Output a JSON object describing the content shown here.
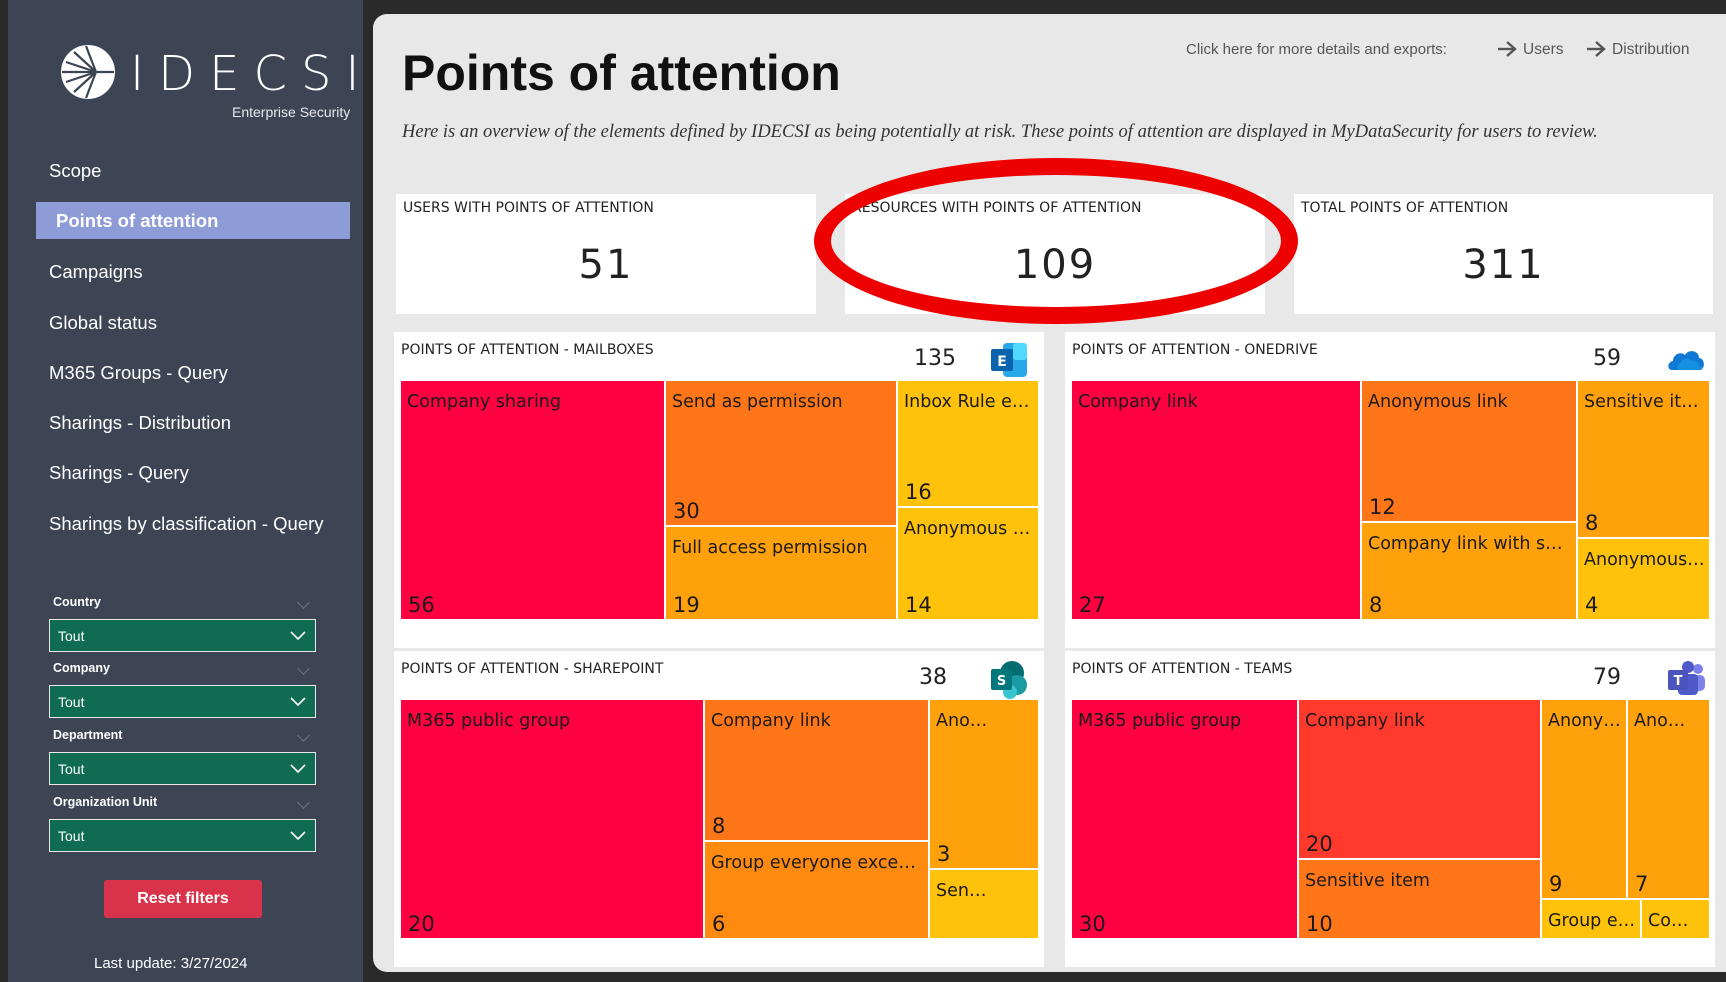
{
  "brand": {
    "name": "IDECSI",
    "tagline": "Enterprise Security"
  },
  "sidebar": {
    "items": [
      {
        "label": "Scope"
      },
      {
        "label": "Points of attention"
      },
      {
        "label": "Campaigns"
      },
      {
        "label": "Global status"
      },
      {
        "label": "M365 Groups - Query"
      },
      {
        "label": "Sharings - Distribution"
      },
      {
        "label": "Sharings - Query"
      },
      {
        "label": "Sharings by classification - Query"
      }
    ],
    "active_item": "Points of attention",
    "filters": [
      {
        "label": "Country",
        "value": "Tout"
      },
      {
        "label": "Company",
        "value": "Tout"
      },
      {
        "label": "Department",
        "value": "Tout"
      },
      {
        "label": "Organization Unit",
        "value": "Tout"
      }
    ],
    "reset_label": "Reset filters",
    "last_update": "Last update:  3/27/2024"
  },
  "header": {
    "title": "Points of attention",
    "subtitle": "Here is an overview of the elements defined by IDECSI as being potentially at risk. These points of attention are displayed in MyDataSecurity for users to review.",
    "exports_prompt": "Click here for more details and exports:",
    "links": [
      {
        "label": "Users"
      },
      {
        "label": "Distribution"
      }
    ]
  },
  "kpis": [
    {
      "label": "USERS WITH POINTS OF ATTENTION",
      "value": "51"
    },
    {
      "label": "RESOURCES WITH POINTS OF ATTENTION",
      "value": "109"
    },
    {
      "label": "TOTAL POINTS OF ATTENTION",
      "value": "311"
    }
  ],
  "treemaps": {
    "mailboxes": {
      "title": "POINTS OF ATTENTION - MAILBOXES",
      "total": "135",
      "icon": "exchange-icon",
      "cells": [
        {
          "label": "Company sharing",
          "value": "56"
        },
        {
          "label": "Send as permission",
          "value": "30"
        },
        {
          "label": "Full access permission",
          "value": "19"
        },
        {
          "label": "Inbox Rule e…",
          "value": "16"
        },
        {
          "label": "Anonymous …",
          "value": "14"
        }
      ]
    },
    "onedrive": {
      "title": "POINTS OF ATTENTION - ONEDRIVE",
      "total": "59",
      "icon": "onedrive-cloud-icon",
      "cells": [
        {
          "label": "Company link",
          "value": "27"
        },
        {
          "label": "Anonymous link",
          "value": "12"
        },
        {
          "label": "Company link with se…",
          "value": "8"
        },
        {
          "label": "Sensitive it…",
          "value": "8"
        },
        {
          "label": "Anonymous…",
          "value": "4"
        }
      ]
    },
    "sharepoint": {
      "title": "POINTS OF ATTENTION - SHAREPOINT",
      "total": "38",
      "icon": "sharepoint-icon",
      "cells": [
        {
          "label": "M365 public group",
          "value": "20"
        },
        {
          "label": "Company link",
          "value": "8"
        },
        {
          "label": "Group everyone except …",
          "value": "6"
        },
        {
          "label": "Ano…",
          "value": "3"
        },
        {
          "label": "Sen…",
          "value": ""
        }
      ]
    },
    "teams": {
      "title": "POINTS OF ATTENTION - TEAMS",
      "total": "79",
      "icon": "teams-icon",
      "cells": [
        {
          "label": "M365 public group",
          "value": "30"
        },
        {
          "label": "Company link",
          "value": "20"
        },
        {
          "label": "Sensitive item",
          "value": "10"
        },
        {
          "label": "Anony…",
          "value": "9"
        },
        {
          "label": "Ano…",
          "value": "7"
        },
        {
          "label": "Group e…",
          "value": ""
        },
        {
          "label": "Co…",
          "value": ""
        }
      ]
    }
  },
  "colors": {
    "sidebar_bg": "#3d4555",
    "active_item": "#8d9bd6",
    "filter_bg": "#0f6b52",
    "reset_button": "#d8334a",
    "highlight": "#ef0000",
    "treemap_red": "#ff0040",
    "treemap_orange": "#ff7618",
    "treemap_amber": "#ffa10a",
    "treemap_yellow": "#ffc20a"
  }
}
